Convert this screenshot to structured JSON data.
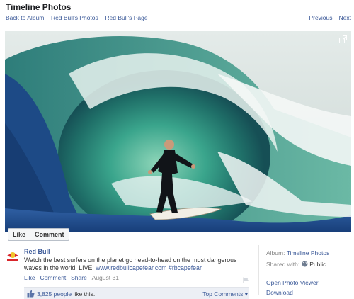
{
  "header": {
    "title": "Timeline Photos",
    "breadcrumbs": [
      "Back to Album",
      "Red Bull's Photos",
      "Red Bull's Page"
    ],
    "breadcrumb_separator": "·",
    "previous_label": "Previous",
    "next_label": "Next"
  },
  "photo": {
    "description_icon": "expand-icon",
    "like_label": "Like",
    "comment_label": "Comment"
  },
  "post": {
    "author": "Red Bull",
    "caption_text": "Watch the best surfers on the planet go head-to-head on the most dangerous waves in the world. LIVE: ",
    "caption_link": "www.redbullcapefear.com",
    "caption_hashtag": "#rbcapefear",
    "actions": [
      "Like",
      "Comment",
      "Share"
    ],
    "date": "August 31",
    "likes_count": "3,825 people",
    "likes_suffix": " like this.",
    "top_comments_label": "Top Comments ▾"
  },
  "sidebar": {
    "album_label": "Album:",
    "album_name": "Timeline Photos",
    "shared_label": "Shared with:",
    "shared_value": "Public",
    "open_viewer_label": "Open Photo Viewer",
    "download_label": "Download"
  },
  "colors": {
    "link": "#3b5998",
    "likes_bar": "#eceff5",
    "brand_red": "#d9262b"
  }
}
